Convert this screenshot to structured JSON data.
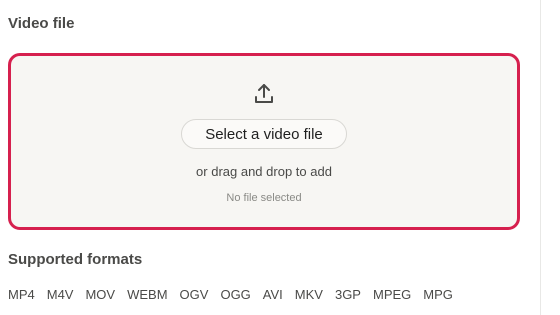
{
  "video_section": {
    "title": "Video file"
  },
  "dropzone": {
    "icon": "upload-icon",
    "select_label": "Select a video file",
    "drag_text": "or drag and drop to add",
    "status": "No file selected",
    "border_color": "#d6204e"
  },
  "formats_section": {
    "title": "Supported formats",
    "formats": [
      "MP4",
      "M4V",
      "MOV",
      "WEBM",
      "OGV",
      "OGG",
      "AVI",
      "MKV",
      "3GP",
      "MPEG",
      "MPG"
    ]
  }
}
